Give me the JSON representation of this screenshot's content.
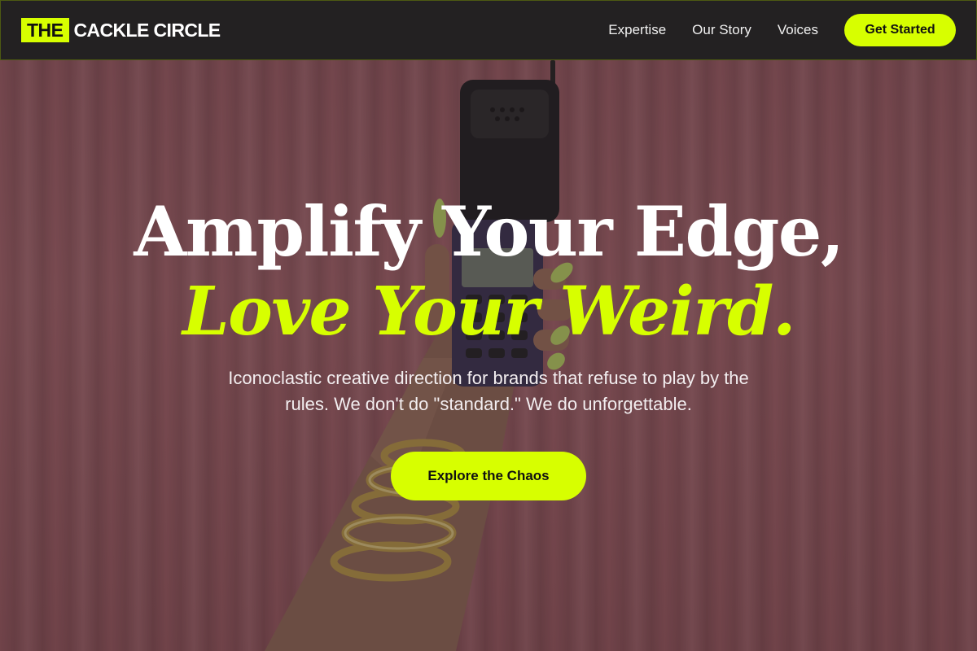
{
  "brand": {
    "logo_mark": "THE",
    "logo_text": "CACKLE CIRCLE",
    "accent_color": "#d7ff00"
  },
  "nav": {
    "links": [
      {
        "label": "Expertise"
      },
      {
        "label": "Our Story"
      },
      {
        "label": "Voices"
      }
    ],
    "cta_label": "Get Started"
  },
  "hero": {
    "headline_line1": "Amplify Your Edge,",
    "headline_line2": "Love Your Weird.",
    "subtitle": "Iconoclastic creative direction for brands that refuse to play by the rules. We don't do \"standard.\" We do unforgettable.",
    "cta_label": "Explore the Chaos",
    "background": {
      "scene": "hand-holding-flip-phone-on-pink-curtain",
      "colors": {
        "curtain": "#b36a73",
        "overlay": "#281e22"
      }
    }
  }
}
